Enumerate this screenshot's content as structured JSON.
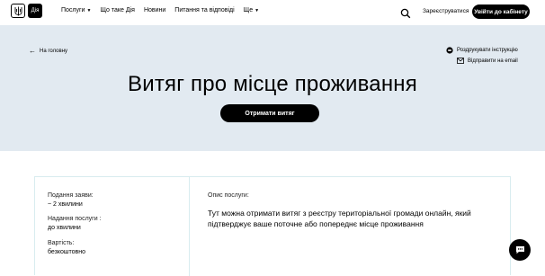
{
  "header": {
    "logo_diia": "Дія",
    "nav": [
      {
        "label": "Послуги",
        "has_caret": true
      },
      {
        "label": "Що таке Дія",
        "has_caret": false
      },
      {
        "label": "Новини",
        "has_caret": false
      },
      {
        "label": "Питання та відповіді",
        "has_caret": false
      },
      {
        "label": "Ще",
        "has_caret": true
      }
    ],
    "register": "Зареєструватися",
    "login": "Увійти до кабінету"
  },
  "hero": {
    "back": "На головну",
    "print": "Роздрукувати інструкцію",
    "email": "Відправити на email",
    "title": "Витяг про місце проживання",
    "button": "Отримати витяг",
    "background": "#e2eaf1"
  },
  "info": {
    "application_label": "Подання заяви:",
    "application_value": "~ 2 хвилини",
    "delivery_label": "Надання послуги :",
    "delivery_value": "до хвилини",
    "cost_label": "Вартість:",
    "cost_value": "безкоштовно",
    "description_label": "Опис послуги:",
    "description": "Тут можна отримати витяг з реєстру територіальної громади онлайн, який підтверджує ваше поточне або попереднє місце проживання"
  }
}
